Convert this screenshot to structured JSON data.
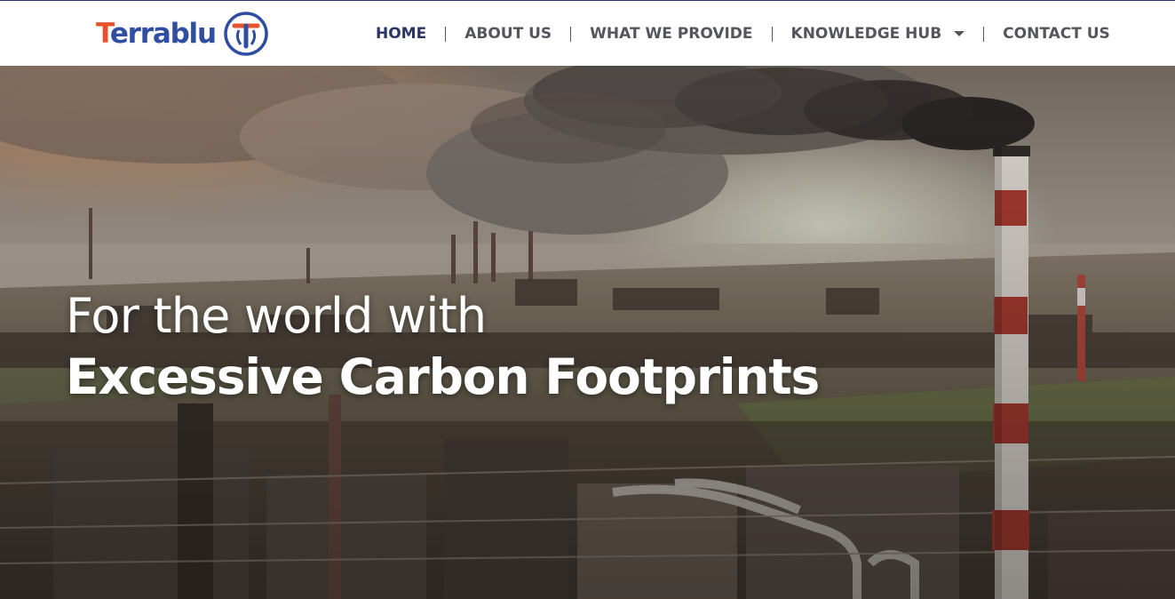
{
  "header": {
    "logo": {
      "text_first": "T",
      "text_rest": "errablu",
      "mark_letter": "T"
    },
    "nav": [
      {
        "label": "HOME",
        "active": true
      },
      {
        "label": "ABOUT US"
      },
      {
        "label": "WHAT WE PROVIDE"
      },
      {
        "label": "KNOWLEDGE HUB",
        "has_dropdown": true
      },
      {
        "label": "CONTACT US"
      }
    ]
  },
  "hero": {
    "line1": "For the world with",
    "line2": "Excessive Carbon Footprints",
    "image": "industrial-refinery-with-smokestacks"
  },
  "colors": {
    "brand_blue": "#2f4ea1",
    "brand_orange": "#e5522c",
    "nav_active": "#2a3566",
    "nav_text": "#55555e"
  }
}
